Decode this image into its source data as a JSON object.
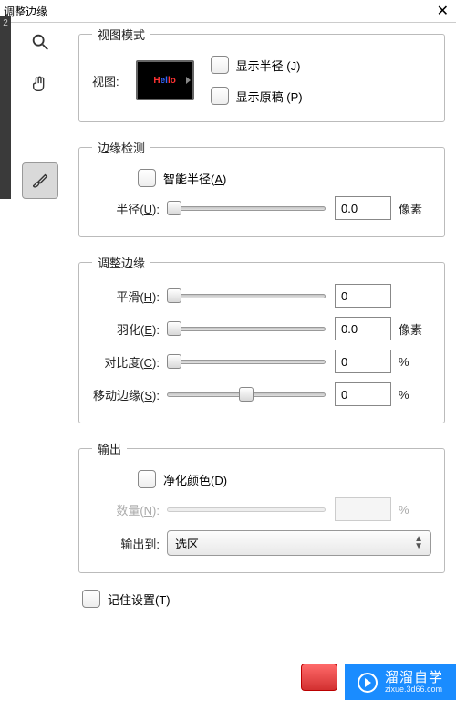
{
  "title": "调整边缘",
  "leftnum": "2",
  "view_mode": {
    "legend": "视图模式",
    "view_label": "视图:",
    "show_radius": "显示半径 (J)",
    "show_original": "显示原稿 (P)"
  },
  "edge_detect": {
    "legend": "边缘检测",
    "smart_radius": "智能半径(",
    "smart_radius_key": "A",
    "smart_radius_end": ")",
    "radius_label_pre": "半径(",
    "radius_label_key": "U",
    "radius_label_end": "):",
    "radius_value": "0.0",
    "radius_unit": "像素"
  },
  "adjust": {
    "legend": "调整边缘",
    "smooth_pre": "平滑(",
    "smooth_key": "H",
    "smooth_end": "):",
    "smooth_value": "0",
    "feather_pre": "羽化(",
    "feather_key": "E",
    "feather_end": "):",
    "feather_value": "0.0",
    "feather_unit": "像素",
    "contrast_pre": "对比度(",
    "contrast_key": "C",
    "contrast_end": "):",
    "contrast_value": "0",
    "contrast_unit": "%",
    "shift_pre": "移动边缘(",
    "shift_key": "S",
    "shift_end": "):",
    "shift_value": "0",
    "shift_unit": "%"
  },
  "output": {
    "legend": "输出",
    "purify_pre": "净化颜色(",
    "purify_key": "D",
    "purify_end": ")",
    "amount_pre": "数量(",
    "amount_key": "N",
    "amount_end": "):",
    "amount_unit": "%",
    "output_to": "输出到:",
    "output_value": "选区"
  },
  "remember": "记住设置(T)",
  "watermark": {
    "big": "溜溜自学",
    "small": "zixue.3d66.com"
  }
}
